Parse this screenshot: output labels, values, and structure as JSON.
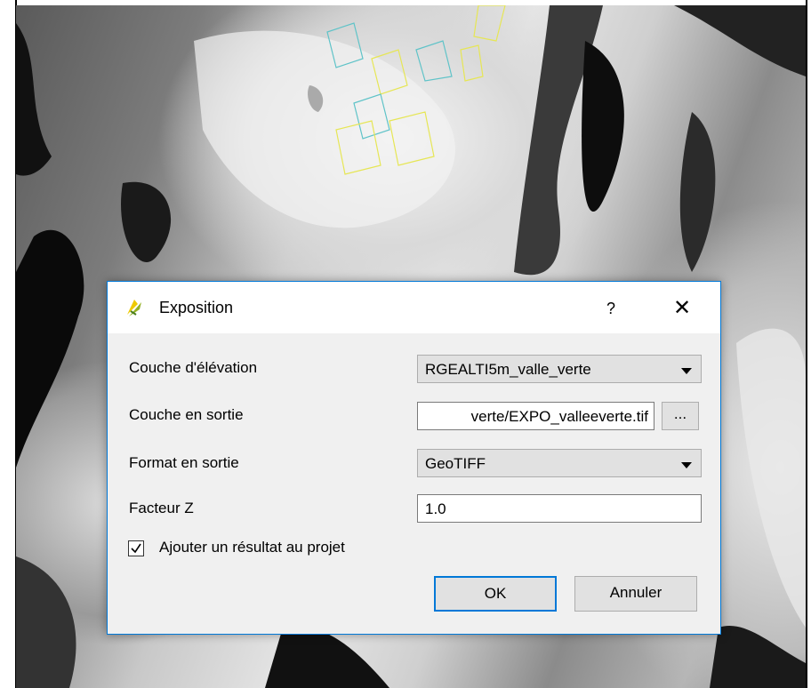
{
  "dialog": {
    "title": "Exposition",
    "help_label": "?",
    "close_label": "✕",
    "fields": {
      "elevation_label": "Couche d'élévation",
      "elevation_value": "RGEALTI5m_valle_verte",
      "output_layer_label": "Couche en sortie",
      "output_layer_value": "verte/EXPO_valleeverte.tif",
      "browse_label": "...",
      "output_format_label": "Format en sortie",
      "output_format_value": "GeoTIFF",
      "zfactor_label": "Facteur Z",
      "zfactor_value": "1.0"
    },
    "add_to_project": {
      "label": "Ajouter un résultat au projet",
      "checked": true
    },
    "ok_label": "OK",
    "cancel_label": "Annuler"
  },
  "colors": {
    "accent": "#0078d7",
    "dialog_bg": "#f0f0f0",
    "qgis_green": "#93b023",
    "qgis_yellow": "#eec900"
  },
  "icons": {
    "app": "qgis-logo-icon",
    "combo_arrow": "chevron-down-icon",
    "check": "checkmark-icon"
  }
}
